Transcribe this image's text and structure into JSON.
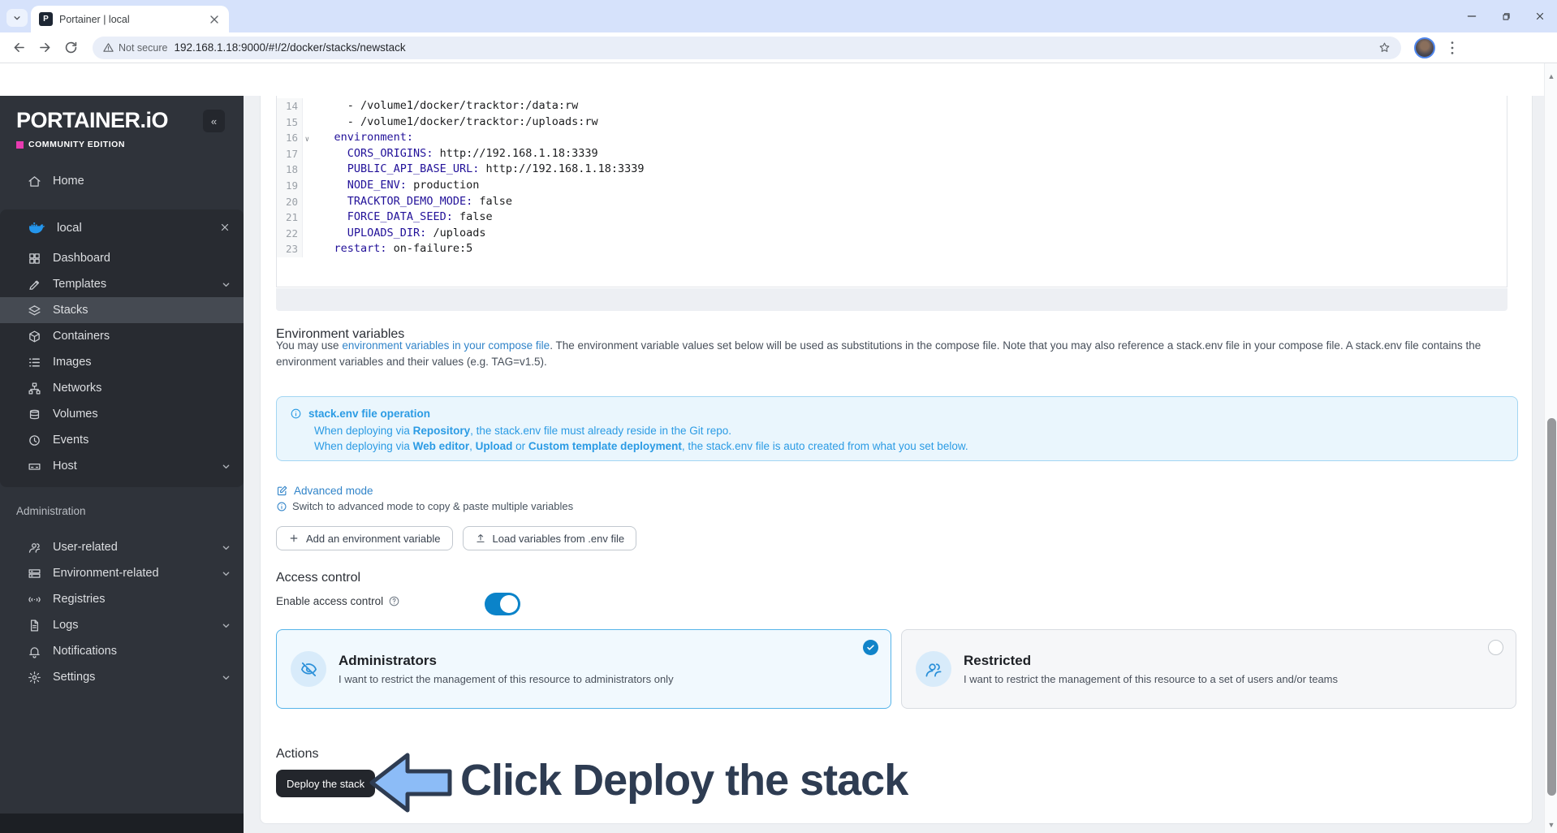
{
  "browser": {
    "tab_title": "Portainer | local",
    "favicon_letter": "P",
    "security_label": "Not secure",
    "url": "192.168.1.18:9000/#!/2/docker/stacks/newstack"
  },
  "colors": {
    "accent_blue": "#0b83c9",
    "info_blue": "#2b9be4",
    "link_blue": "#3184c9",
    "selected_card_border": "#56b4e9",
    "sidebar_bg": "#2f333a",
    "edition_pink": "#e83bb0",
    "docker_blue": "#2496ed",
    "yaml_key": "#221199",
    "annotation": "#2e3c52",
    "arrow_fill": "#8cbcf7"
  },
  "sidebar": {
    "logo_text": "PORTAINER.iO",
    "edition": "COMMUNITY EDITION",
    "collapse_glyph": "«",
    "home_label": "Home",
    "environment": {
      "name": "local",
      "items": [
        {
          "label": "Dashboard",
          "icon": "grid"
        },
        {
          "label": "Templates",
          "icon": "edit",
          "chevron": true
        },
        {
          "label": "Stacks",
          "icon": "layers",
          "selected": true
        },
        {
          "label": "Containers",
          "icon": "cube"
        },
        {
          "label": "Images",
          "icon": "list"
        },
        {
          "label": "Networks",
          "icon": "network"
        },
        {
          "label": "Volumes",
          "icon": "db"
        },
        {
          "label": "Events",
          "icon": "clock"
        },
        {
          "label": "Host",
          "icon": "host",
          "chevron": true
        }
      ]
    },
    "admin": {
      "label": "Administration",
      "items": [
        {
          "label": "User-related",
          "icon": "users",
          "chevron": true
        },
        {
          "label": "Environment-related",
          "icon": "server",
          "chevron": true
        },
        {
          "label": "Registries",
          "icon": "broadcast"
        },
        {
          "label": "Logs",
          "icon": "file",
          "chevron": true
        },
        {
          "label": "Notifications",
          "icon": "bell"
        },
        {
          "label": "Settings",
          "icon": "gear",
          "chevron": true
        }
      ]
    }
  },
  "editor": {
    "lines": [
      {
        "n": "14",
        "segs": [
          {
            "t": "      - /volume1/docker/tracktor:/data:rw"
          }
        ]
      },
      {
        "n": "15",
        "segs": [
          {
            "t": "      - /volume1/docker/tracktor:/uploads:rw"
          }
        ]
      },
      {
        "n": "16",
        "fold": true,
        "segs": [
          {
            "t": "    "
          },
          {
            "t": "environment:",
            "c": "key"
          }
        ]
      },
      {
        "n": "17",
        "segs": [
          {
            "t": "      "
          },
          {
            "t": "CORS_ORIGINS:",
            "c": "key"
          },
          {
            "t": " http://192.168.1.18:3339"
          }
        ]
      },
      {
        "n": "18",
        "segs": [
          {
            "t": "      "
          },
          {
            "t": "PUBLIC_API_BASE_URL:",
            "c": "key"
          },
          {
            "t": " http://192.168.1.18:3339"
          }
        ]
      },
      {
        "n": "19",
        "segs": [
          {
            "t": "      "
          },
          {
            "t": "NODE_ENV:",
            "c": "key"
          },
          {
            "t": " production"
          }
        ]
      },
      {
        "n": "20",
        "segs": [
          {
            "t": "      "
          },
          {
            "t": "TRACKTOR_DEMO_MODE:",
            "c": "key"
          },
          {
            "t": " false"
          }
        ]
      },
      {
        "n": "21",
        "segs": [
          {
            "t": "      "
          },
          {
            "t": "FORCE_DATA_SEED:",
            "c": "key"
          },
          {
            "t": " false"
          }
        ]
      },
      {
        "n": "22",
        "segs": [
          {
            "t": "      "
          },
          {
            "t": "UPLOADS_DIR:",
            "c": "key"
          },
          {
            "t": " /uploads"
          }
        ]
      },
      {
        "n": "23",
        "segs": [
          {
            "t": "    "
          },
          {
            "t": "restart:",
            "c": "key"
          },
          {
            "t": " on-failure:5"
          }
        ]
      }
    ]
  },
  "env_section": {
    "heading": "Environment variables",
    "para": [
      {
        "t": "You may use "
      },
      {
        "t": "environment variables in your compose file",
        "link": true
      },
      {
        "t": ". The environment variable values set below will be used as substitutions in the compose file. Note that you may also reference a stack.env file in your compose file. A stack.env file contains the environment variables and their values (e.g. TAG=v1.5)."
      }
    ],
    "info_box": {
      "title": "stack.env file operation",
      "lines": [
        [
          {
            "t": "When deploying via "
          },
          {
            "t": "Repository",
            "b": true
          },
          {
            "t": ", the stack.env file must already reside in the Git repo."
          }
        ],
        [
          {
            "t": "When deploying via "
          },
          {
            "t": "Web editor",
            "b": true
          },
          {
            "t": ", "
          },
          {
            "t": "Upload",
            "b": true
          },
          {
            "t": " or "
          },
          {
            "t": "Custom template deployment",
            "b": true
          },
          {
            "t": ", the stack.env file is auto created from what you set below."
          }
        ]
      ]
    },
    "advanced_mode": "Advanced mode",
    "advanced_hint": "Switch to advanced mode to copy & paste multiple variables",
    "add_button": "Add an environment variable",
    "load_button": "Load variables from .env file"
  },
  "access_control": {
    "heading": "Access control",
    "toggle_label": "Enable access control",
    "toggle_on": true,
    "cards": {
      "administrators": {
        "title": "Administrators",
        "desc": "I want to restrict the management of this resource to administrators only",
        "selected": true
      },
      "restricted": {
        "title": "Restricted",
        "desc": "I want to restrict the management of this resource to a set of users and/or teams",
        "selected": false
      }
    }
  },
  "actions": {
    "heading": "Actions",
    "deploy_button": "Deploy the stack"
  },
  "annotation": {
    "text": "Click Deploy the stack"
  }
}
